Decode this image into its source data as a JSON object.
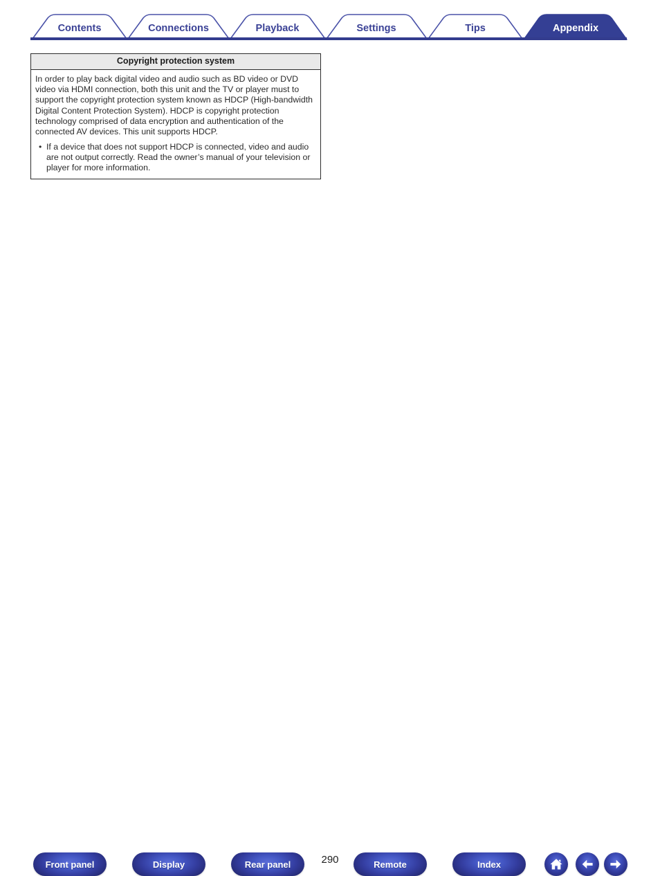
{
  "tabs": [
    {
      "label": "Contents",
      "active": false
    },
    {
      "label": "Connections",
      "active": false
    },
    {
      "label": "Playback",
      "active": false
    },
    {
      "label": "Settings",
      "active": false
    },
    {
      "label": "Tips",
      "active": false
    },
    {
      "label": "Appendix",
      "active": true
    }
  ],
  "content": {
    "header": "Copyright protection system",
    "paragraph": "In order to play back digital video and audio such as BD video or DVD video via HDMI connection, both this unit and the TV or player must to support the copyright protection system known as HDCP (High-bandwidth Digital Content Protection System). HDCP is copyright protection technology comprised of data encryption and authentication of the connected AV devices. This unit supports HDCP.",
    "bullets": [
      "If a device that does not support HDCP is connected, video and audio are not output correctly. Read the owner’s manual of your television or player for more information."
    ],
    "bullet_glyph": "•"
  },
  "footer": {
    "buttons": [
      {
        "label": "Front panel"
      },
      {
        "label": "Display"
      },
      {
        "label": "Rear panel"
      },
      {
        "label": "Remote"
      },
      {
        "label": "Index"
      }
    ],
    "page_number": "290",
    "icons": [
      {
        "name": "home-icon"
      },
      {
        "name": "arrow-left-icon"
      },
      {
        "name": "arrow-right-icon"
      }
    ]
  },
  "colors": {
    "tab_text": "#3b4296",
    "tab_outline": "#4a52a8",
    "tab_active_fill": "#343f94",
    "tab_rule": "#333c8e",
    "button_blue": "#333c9e",
    "header_bg": "#e9e9e9",
    "box_border": "#2b2b2b",
    "body_text": "#2a2a2a"
  }
}
